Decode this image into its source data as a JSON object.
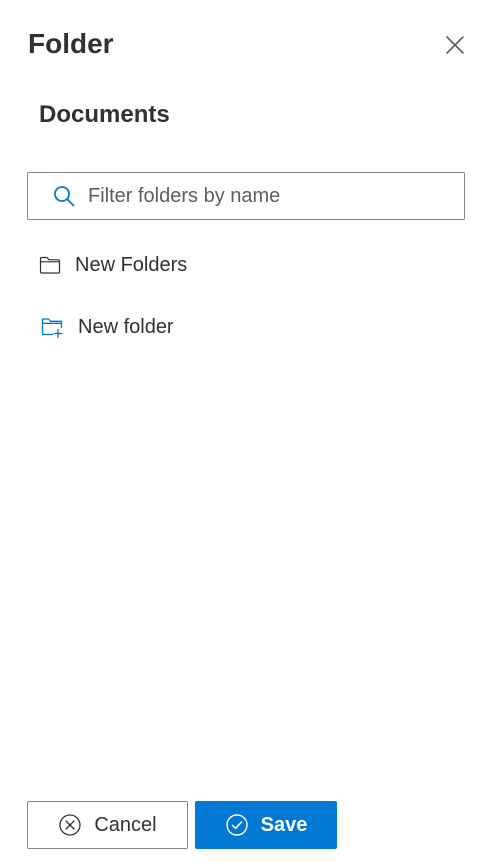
{
  "panel": {
    "title": "Folder",
    "close_icon": "close-icon"
  },
  "breadcrumb": {
    "current": "Documents"
  },
  "search": {
    "placeholder": "Filter folders by name",
    "value": "",
    "icon": "search-icon"
  },
  "folders": {
    "items": [
      {
        "label": "New Folders",
        "icon": "folder-icon"
      }
    ]
  },
  "actions": {
    "new_folder_label": "New folder",
    "new_folder_icon": "folder-add-icon"
  },
  "footer": {
    "cancel_label": "Cancel",
    "cancel_icon": "cancel-circle-icon",
    "save_label": "Save",
    "save_icon": "check-circle-icon"
  },
  "colors": {
    "accent": "#0078d4",
    "text": "#323130",
    "border": "#8a8886"
  }
}
